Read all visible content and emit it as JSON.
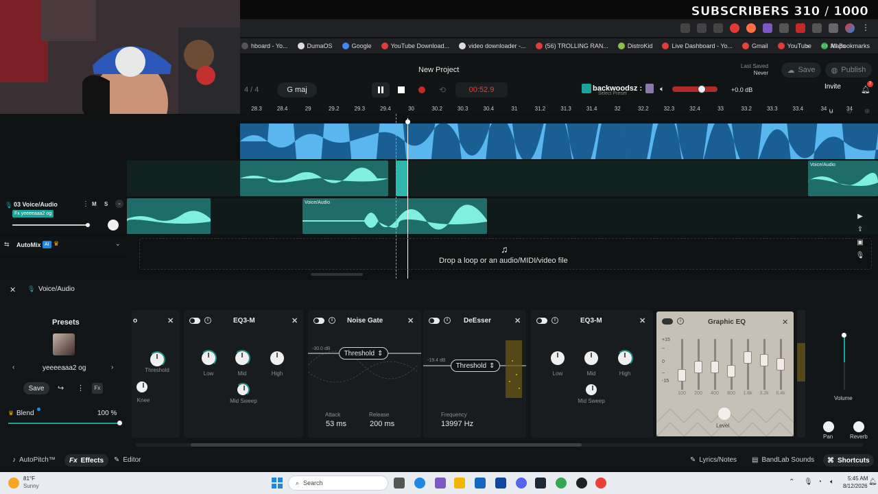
{
  "overlay": {
    "subscribers": "SUBSCRIBERS 310 / 1000"
  },
  "bookmarks": [
    {
      "label": "hboard - Yo...",
      "color": "#555"
    },
    {
      "label": "DumaOS",
      "color": "#ddd"
    },
    {
      "label": "Google",
      "color": "#4285f4"
    },
    {
      "label": "YouTube Download...",
      "color": "#e23b3b"
    },
    {
      "label": "video downloader -...",
      "color": "#ddd"
    },
    {
      "label": "(56) TROLLING RAN...",
      "color": "#e23b3b"
    },
    {
      "label": "DistroKid",
      "color": "#8bc34a"
    },
    {
      "label": "Live Dashboard - Yo...",
      "color": "#e23b3b"
    },
    {
      "label": "Gmail",
      "color": "#ea4335"
    },
    {
      "label": "YouTube",
      "color": "#e23b3b"
    },
    {
      "label": "Maps",
      "color": "#34a853"
    }
  ],
  "all_bookmarks": "All Bookmarks",
  "header": {
    "project_title": "New Project",
    "last_saved_label": "Last Saved",
    "last_saved_value": "Never",
    "save_label": "Save",
    "publish_label": "Publish",
    "time_signature": "4 / 4",
    "key": "G maj",
    "timecode": "00:52.9",
    "preset_name": "backwoodsz :",
    "preset_sub": "Select Preset",
    "db_readout": "+0.0 dB",
    "invite": "Invite",
    "notif_count": "2"
  },
  "ruler": [
    "28.3",
    "28.4",
    "29",
    "29.2",
    "29.3",
    "29.4",
    "30",
    "30.2",
    "30.3",
    "30.4",
    "31",
    "31.2",
    "31.3",
    "31.4",
    "32",
    "32.2",
    "32.3",
    "32.4",
    "33",
    "33.2",
    "33.3",
    "33.4",
    "34",
    "34"
  ],
  "tracks": {
    "track3_name": "03  Voice/Audio",
    "track3_fx": "Fx yeeeeaaa2 og",
    "clip_label": "Voice/Audio",
    "automix": "AutoMix",
    "ai_badge": "AI",
    "drop_text": "Drop a loop or an audio/MIDI/video file"
  },
  "fx_panel": {
    "title": "Voice/Audio",
    "presets_title": "Presets",
    "preset_value": "yeeeeaaa2 og",
    "save": "Save",
    "blend_label": "Blend",
    "blend_value": "100 %",
    "blend_level": 1.0,
    "cards": {
      "partial": {
        "threshold": "Threshold",
        "knee": "Knee"
      },
      "eq3a": {
        "name": "EQ3-M",
        "low": "Low",
        "mid": "Mid",
        "high": "High",
        "mid_sweep": "Mid Sweep"
      },
      "gate": {
        "name": "Noise Gate",
        "db": "-30.0 dB",
        "threshold": "Threshold",
        "attack_label": "Attack",
        "attack": "53 ms",
        "release_label": "Release",
        "release": "200 ms"
      },
      "deesser": {
        "name": "DeEsser",
        "db": "-19.4 dB",
        "threshold": "Threshold",
        "frequency_label": "Frequency",
        "frequency": "13997 Hz"
      },
      "eq3b": {
        "name": "EQ3-M",
        "low": "Low",
        "mid": "Mid",
        "high": "High",
        "mid_sweep": "Mid Sweep"
      },
      "geq": {
        "name": "Graphic EQ",
        "db_marks": [
          "+15",
          "0",
          "-15"
        ],
        "bands": [
          "100",
          "200",
          "400",
          "800",
          "1.6k",
          "3.2k",
          "6.4k"
        ],
        "level": "Level"
      }
    },
    "volume": "Volume",
    "pan": "Pan",
    "reverb": "Reverb"
  },
  "bottom_bar": {
    "autopitch": "AutoPitch™",
    "effects": "Effects",
    "editor": "Editor",
    "lyrics": "Lyrics/Notes",
    "sounds": "BandLab Sounds",
    "shortcuts": "Shortcuts"
  },
  "taskbar": {
    "temp": "81°F",
    "weather": "Sunny",
    "search": "Search",
    "time": "5:45 AM",
    "date": "8/12/2026"
  }
}
